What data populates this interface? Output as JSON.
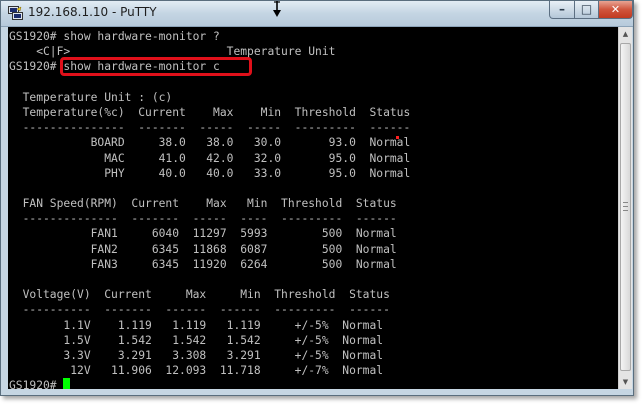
{
  "window": {
    "title": "192.168.1.10 - PuTTY",
    "minimize_glyph": "–",
    "maximize_glyph": "□",
    "close_glyph": "✕"
  },
  "colors": {
    "terminal_bg": "#000000",
    "terminal_fg": "#c0c0c0",
    "cursor": "#00ff00",
    "highlight_box": "#e0101a"
  },
  "icons": {
    "app": "putty-icon",
    "mouse_pointer": "arrow-cursor-icon"
  },
  "terminal": {
    "lines": [
      "GS1920# show hardware-monitor ?",
      "    <C|F>                       Temperature Unit",
      "GS1920# show hardware-monitor c",
      "",
      "  Temperature Unit : (c)",
      "  Temperature(%c)  Current    Max    Min  Threshold  Status",
      "  ---------------  -------  -----  -----  ---------  ------",
      "            BOARD     38.0   38.0   30.0       93.0  Normal",
      "              MAC     41.0   42.0   32.0       95.0  Normal",
      "              PHY     40.0   40.0   33.0       95.0  Normal",
      "",
      "  FAN Speed(RPM)  Current    Max   Min  Threshold  Status",
      "  --------------  -------  -----  ----  ---------  ------",
      "            FAN1     6040  11297  5993        500  Normal",
      "            FAN2     6345  11868  6087        500  Normal",
      "            FAN3     6345  11920  6264        500  Normal",
      "",
      "  Voltage(V)  Current     Max     Min  Threshold  Status",
      "  ----------  -------  ------  ------  ---------  ------",
      "        1.1V    1.119   1.119   1.119     +/-5%  Normal",
      "        1.5V    1.542   1.542   1.542     +/-5%  Normal",
      "        3.3V    3.291   3.308   3.291     +/-5%  Normal",
      "         12V   11.906  12.093  11.718     +/-7%  Normal"
    ],
    "prompt": "GS1920# "
  }
}
